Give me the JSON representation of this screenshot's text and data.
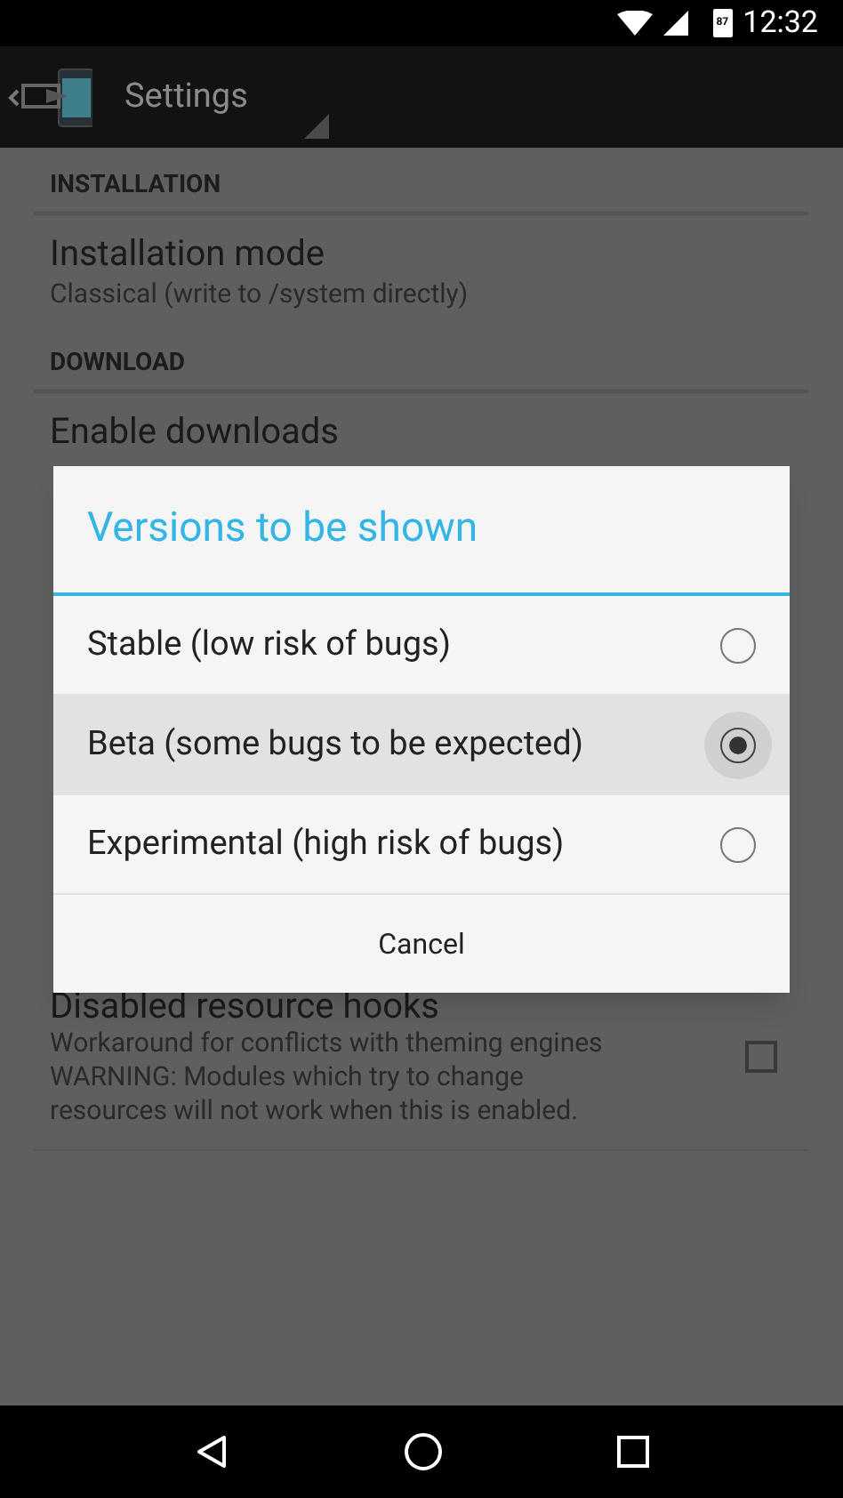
{
  "status_bar": {
    "battery": "87",
    "time": "12:32"
  },
  "action_bar": {
    "title": "Settings"
  },
  "sections": [
    {
      "header": "INSTALLATION",
      "items": [
        {
          "title": "Installation mode",
          "summary": "Classical (write to /system directly)"
        }
      ]
    },
    {
      "header": "DOWNLOAD",
      "items": [
        {
          "title": "Enable downloads"
        }
      ]
    }
  ],
  "lower_item": {
    "title": "Disabled resource hooks",
    "summary": "Workaround for conflicts with theming engines WARNING: Modules which try to change resources will not work when this is enabled.",
    "checked": false
  },
  "dialog": {
    "title": "Versions to be shown",
    "options": [
      {
        "label": "Stable (low risk of bugs)",
        "selected": false
      },
      {
        "label": "Beta (some bugs to be expected)",
        "selected": true
      },
      {
        "label": "Experimental (high risk of bugs)",
        "selected": false
      }
    ],
    "button": "Cancel"
  }
}
